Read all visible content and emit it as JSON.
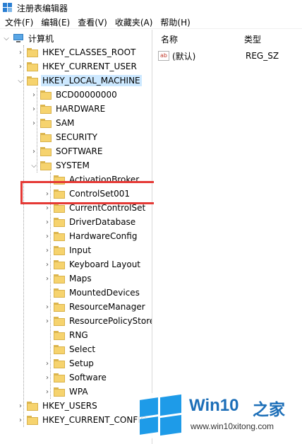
{
  "window": {
    "title": "注册表编辑器",
    "icon": "regedit-icon"
  },
  "menu": [
    "文件(F)",
    "编辑(E)",
    "查看(V)",
    "收藏夹(A)",
    "帮助(H)"
  ],
  "tree": {
    "root": "计算机",
    "hives": [
      "HKEY_CLASSES_ROOT",
      "HKEY_CURRENT_USER",
      "HKEY_LOCAL_MACHINE",
      "HKEY_USERS",
      "HKEY_CURRENT_CONFIG"
    ],
    "hklm_children": [
      "BCD00000000",
      "HARDWARE",
      "SAM",
      "SECURITY",
      "SOFTWARE",
      "SYSTEM"
    ],
    "system_children": [
      "ActivationBroker",
      "ControlSet001",
      "CurrentControlSet",
      "DriverDatabase",
      "HardwareConfig",
      "Input",
      "Keyboard Layout",
      "Maps",
      "MountedDevices",
      "ResourceManager",
      "ResourcePolicyStore",
      "RNG",
      "Select",
      "Setup",
      "Software",
      "WPA"
    ],
    "selected": "HKEY_LOCAL_MACHINE",
    "highlighted": "ControlSet001"
  },
  "values": {
    "columns": [
      "名称",
      "类型"
    ],
    "rows": [
      {
        "name": "(默认)",
        "type": "REG_SZ",
        "icon": "string-value-icon"
      }
    ]
  },
  "watermark": {
    "brand": "Win10",
    "brand_suffix": "之家",
    "url": "www.win10xitong.com"
  }
}
